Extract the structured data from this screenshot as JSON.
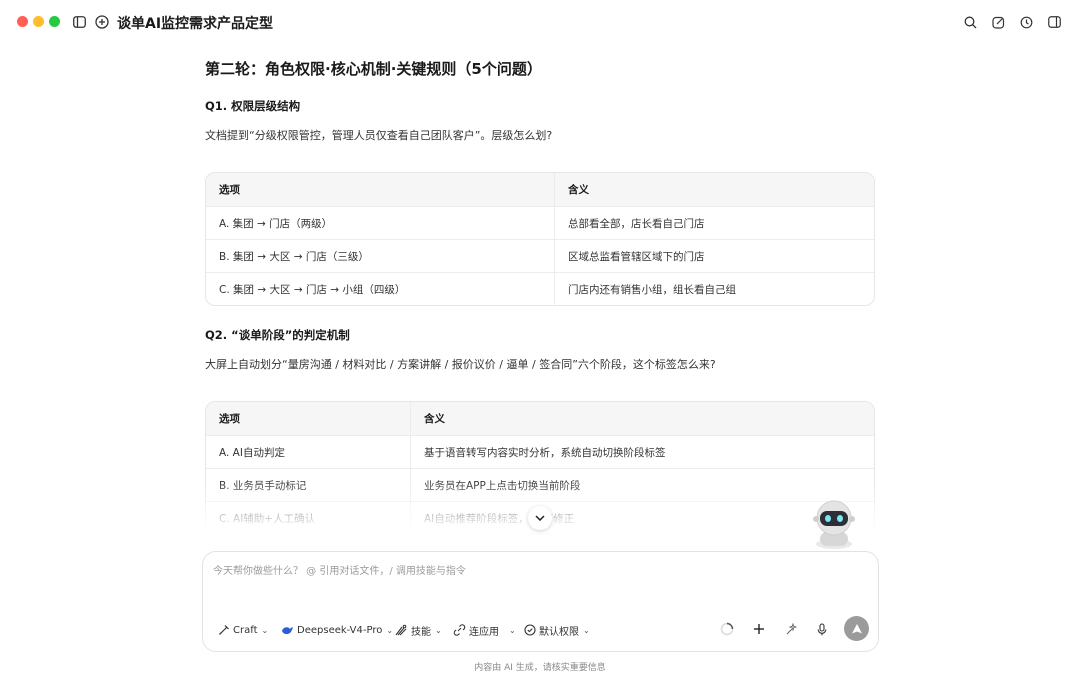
{
  "window": {
    "title": "谈单AI监控需求产品定型"
  },
  "content": {
    "heading": "第二轮：角色权限·核心机制·关键规则（5个问题）",
    "q1": {
      "title": "Q1. 权限层级结构",
      "text": "文档提到“分级权限管控，管理人员仅查看自己团队客户”。层级怎么划?",
      "table": {
        "headers": [
          "选项",
          "含义"
        ],
        "rows": [
          [
            "A. 集团 → 门店（两级）",
            "总部看全部，店长看自己门店"
          ],
          [
            "B. 集团 → 大区 → 门店（三级）",
            "区域总监看管辖区域下的门店"
          ],
          [
            "C. 集团 → 大区 → 门店 → 小组（四级）",
            "门店内还有销售小组，组长看自己组"
          ]
        ]
      }
    },
    "q2": {
      "title": "Q2. “谈单阶段”的判定机制",
      "text": "大屏上自动划分“量房沟通 / 材料对比 / 方案讲解 / 报价议价 / 逼单 / 签合同”六个阶段，这个标签怎么来?",
      "table": {
        "headers": [
          "选项",
          "含义"
        ],
        "rows": [
          [
            "A. AI自动判定",
            "基于语音转写内容实时分析，系统自动切换阶段标签"
          ],
          [
            "B. 业务员手动标记",
            "业务员在APP上点击切换当前阶段"
          ],
          [
            "C. AI辅助+人工确认",
            "AI自动推荐阶段标签，   员可修正"
          ]
        ]
      }
    }
  },
  "composer": {
    "placeholder": "今天帮你做些什么？ @ 引用对话文件，/ 调用技能与指令",
    "tools": {
      "mode": "Craft",
      "model": "Deepseek-V4-Pro",
      "skills": "技能",
      "apps": "连应用",
      "permission": "默认权限"
    }
  },
  "footer": {
    "note": "内容由 AI 生成，请核实重要信息"
  },
  "colors": {
    "close": "#ff5f57",
    "minimize": "#febc2e",
    "maximize": "#28c840",
    "send_button": "#9b9b9b",
    "model_accent": "#2f5bd6"
  }
}
